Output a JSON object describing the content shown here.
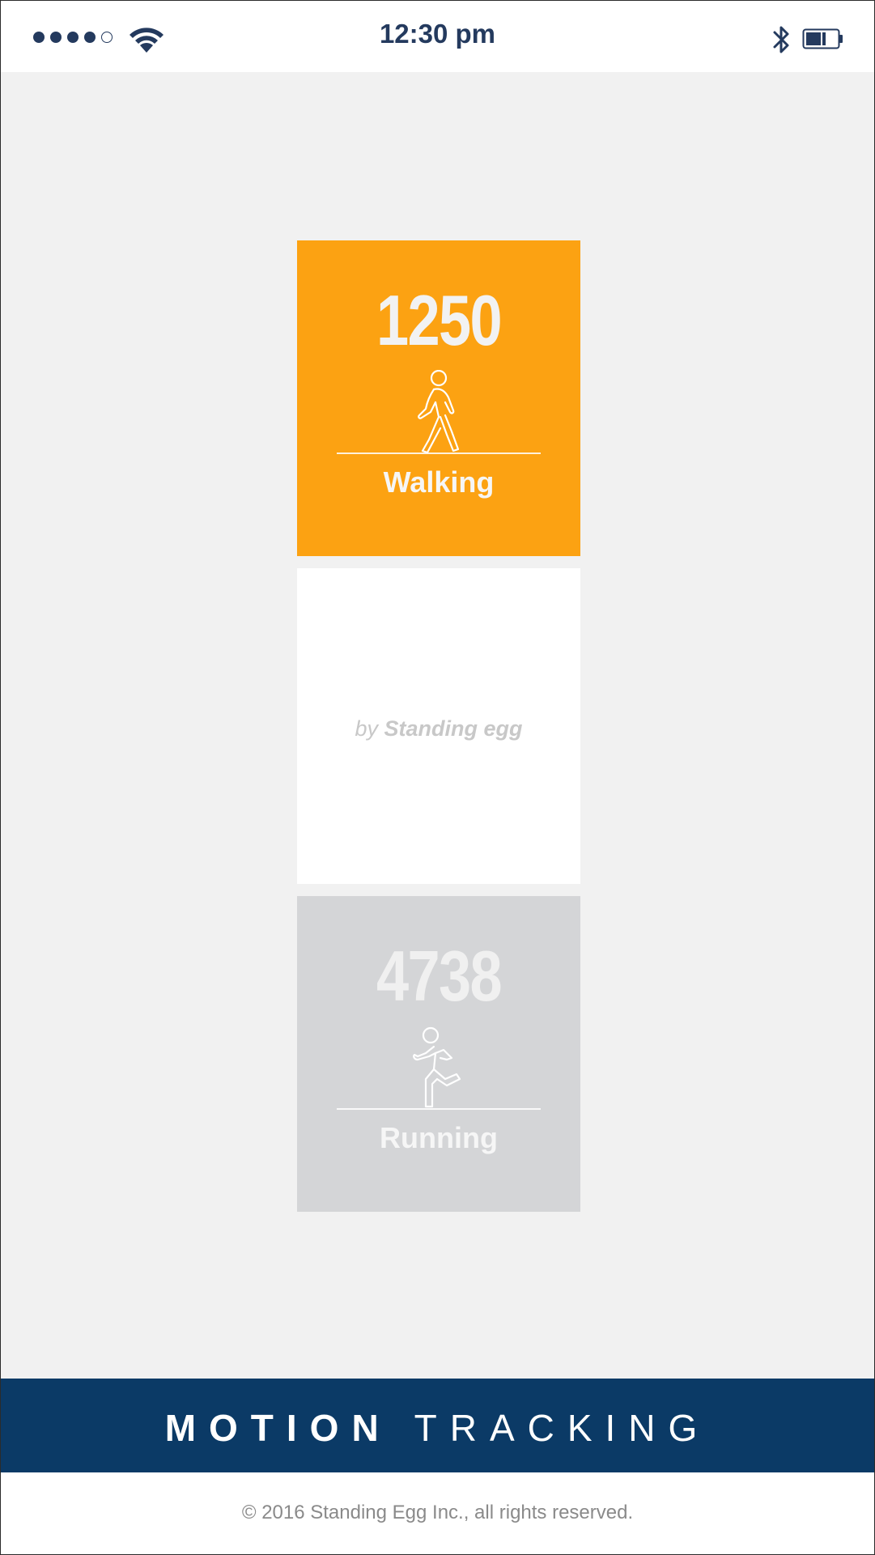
{
  "status_bar": {
    "signal_bars_filled": 4,
    "signal_bars_total": 5,
    "time": "12:30 pm",
    "icons": [
      "signal-dots-icon",
      "wifi-icon",
      "bluetooth-icon",
      "battery-icon"
    ],
    "battery_level": 0.5
  },
  "cards": {
    "walking": {
      "count": "1250",
      "label": "Walking",
      "icon": "walking-person-icon",
      "color": "#fca212"
    },
    "ad": {
      "by": "by",
      "brand": "Standing egg"
    },
    "running": {
      "count": "4738",
      "label": "Running",
      "icon": "running-person-icon",
      "color": "#d4d5d7"
    }
  },
  "title_bar": {
    "bold": "MOTION",
    "light": "TRACKING",
    "color": "#0b3a66"
  },
  "footer": {
    "copyright": "© 2016 Standing Egg Inc., all rights reserved."
  }
}
